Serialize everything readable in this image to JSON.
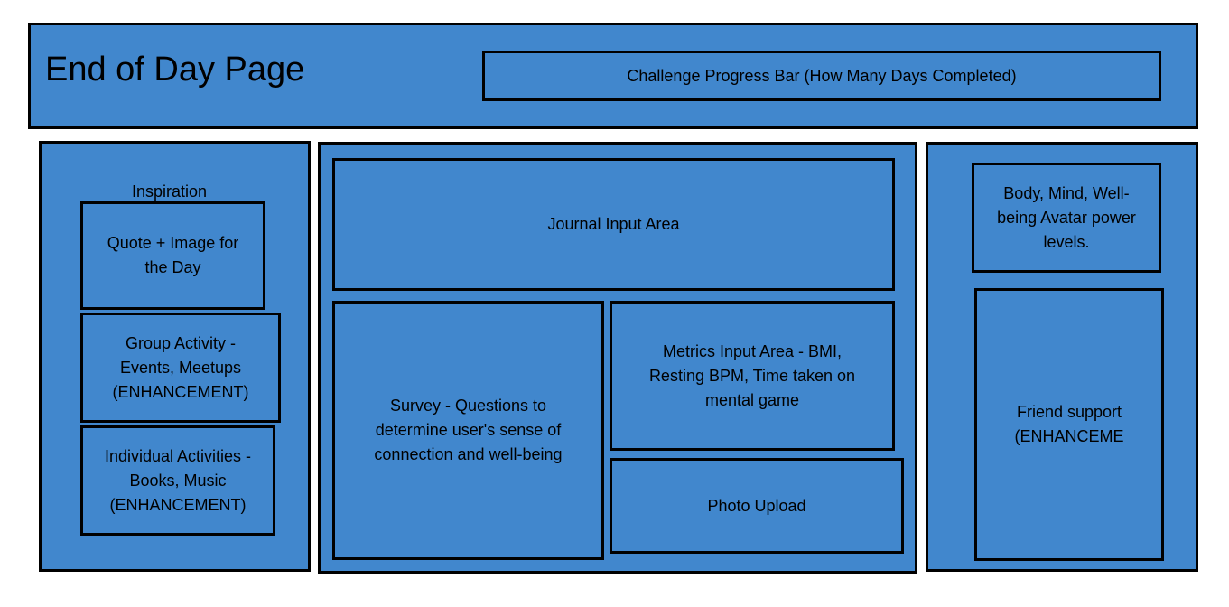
{
  "header": {
    "title": "End of Day Page",
    "progress_bar_label": "Challenge Progress Bar (How Many Days Completed)"
  },
  "left_panel": {
    "heading": "Inspiration",
    "quote_box": "Quote + Image for\nthe Day",
    "group_activity_box": "Group Activity -\nEvents, Meetups\n(ENHANCEMENT)",
    "individual_activities_box": "Individual Activities -\nBooks, Music\n(ENHANCEMENT)"
  },
  "center_panel": {
    "journal_box": "Journal Input Area",
    "survey_box": "Survey - Questions to\ndetermine user's sense of\nconnection and well-being",
    "metrics_box": "Metrics Input Area - BMI,\nResting BPM, Time taken on\nmental game",
    "photo_upload_box": "Photo Upload"
  },
  "right_panel": {
    "avatar_box": "Body, Mind, Well-\nbeing Avatar power\nlevels.",
    "friend_support_box": "Friend support\n(ENHANCEME"
  },
  "colors": {
    "fill": "#4187cd",
    "stroke": "#000000"
  }
}
